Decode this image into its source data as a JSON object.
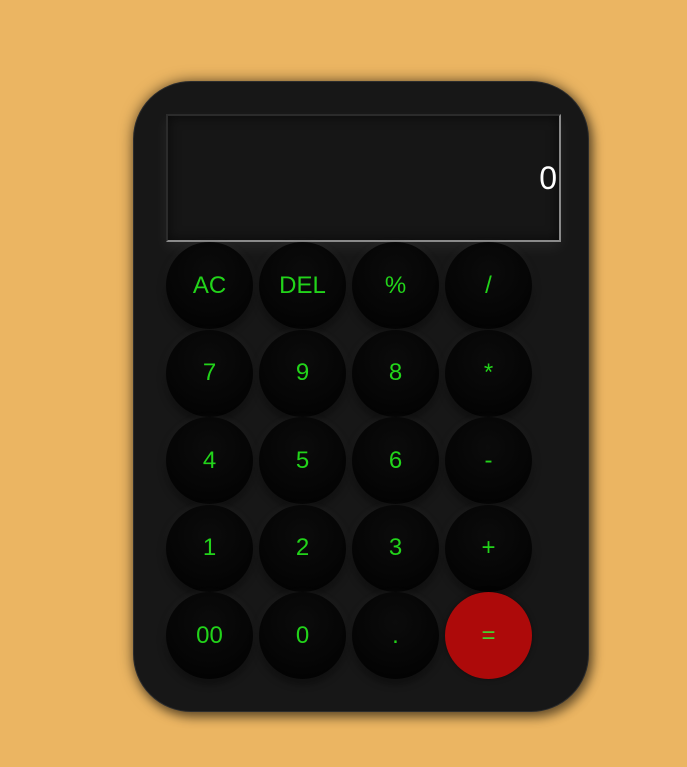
{
  "display": {
    "value": "0"
  },
  "keys": [
    {
      "label": "AC",
      "name": "key-ac"
    },
    {
      "label": "DEL",
      "name": "key-delete"
    },
    {
      "label": "%",
      "name": "key-percent"
    },
    {
      "label": "/",
      "name": "key-divide"
    },
    {
      "label": "7",
      "name": "key-7"
    },
    {
      "label": "9",
      "name": "key-9"
    },
    {
      "label": "8",
      "name": "key-8"
    },
    {
      "label": "*",
      "name": "key-multiply"
    },
    {
      "label": "4",
      "name": "key-4"
    },
    {
      "label": "5",
      "name": "key-5"
    },
    {
      "label": "6",
      "name": "key-6"
    },
    {
      "label": "-",
      "name": "key-subtract"
    },
    {
      "label": "1",
      "name": "key-1"
    },
    {
      "label": "2",
      "name": "key-2"
    },
    {
      "label": "3",
      "name": "key-3"
    },
    {
      "label": "+",
      "name": "key-add"
    },
    {
      "label": "00",
      "name": "key-00"
    },
    {
      "label": "0",
      "name": "key-0"
    },
    {
      "label": ".",
      "name": "key-decimal"
    },
    {
      "label": "=",
      "name": "key-equals"
    }
  ],
  "colors": {
    "background": "#EBB562",
    "body": "#171717",
    "key_text": "#22D41A",
    "equals_key": "#AD0A0A",
    "display_text": "#FFFFFF"
  }
}
